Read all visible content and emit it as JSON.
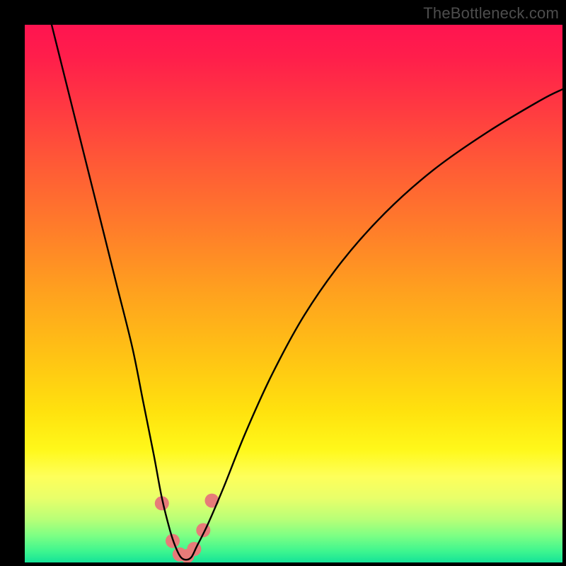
{
  "attribution": "TheBottleneck.com",
  "chart_data": {
    "type": "line",
    "title": "",
    "xlabel": "",
    "ylabel": "",
    "xlim": [
      0,
      100
    ],
    "ylim": [
      0,
      100
    ],
    "grid": false,
    "legend": false,
    "gradient_meaning": "background color indicates bottleneck severity: red=high, green=low",
    "series": [
      {
        "name": "bottleneck-curve",
        "color": "#000000",
        "x": [
          5,
          8,
          11,
          14,
          17,
          20,
          22,
          24,
          25.5,
          27,
          28,
          29,
          30,
          31,
          32,
          34,
          37,
          41,
          46,
          52,
          59,
          67,
          76,
          86,
          96,
          100
        ],
        "y": [
          100,
          88,
          76,
          64,
          52,
          40,
          30,
          20,
          12,
          6,
          3,
          1,
          0.5,
          1,
          3,
          7,
          14,
          24,
          35,
          46,
          56,
          65,
          73,
          80,
          86,
          88
        ]
      }
    ],
    "markers": {
      "name": "highlight-points",
      "shape": "circle",
      "radius": 10,
      "fill": "#e77b79",
      "points": [
        {
          "x": 25.5,
          "y": 11
        },
        {
          "x": 27.5,
          "y": 4
        },
        {
          "x": 28.8,
          "y": 1.5
        },
        {
          "x": 30.2,
          "y": 1.2
        },
        {
          "x": 31.5,
          "y": 2.5
        },
        {
          "x": 33.2,
          "y": 6
        },
        {
          "x": 34.8,
          "y": 11.5
        }
      ]
    }
  },
  "colors": {
    "frame": "#000000",
    "curve": "#000000",
    "marker": "#e77b79",
    "attribution": "#4d4d4d"
  }
}
